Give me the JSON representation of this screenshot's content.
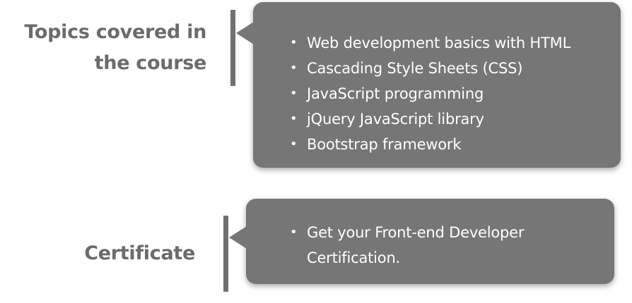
{
  "sections": [
    {
      "heading_lines": [
        "Topics covered in",
        "the course"
      ],
      "items": [
        "Web development basics with HTML",
        "Cascading Style Sheets (CSS)",
        "JavaScript programming",
        "jQuery JavaScript library",
        "Bootstrap framework"
      ]
    },
    {
      "heading_lines": [
        "Certificate"
      ],
      "items": [
        "Get your Front-end Developer Certification."
      ]
    }
  ],
  "colors": {
    "heading": "#6b6b6b",
    "bubble_bg": "#767676",
    "bubble_text": "#ffffff",
    "bar": "#707070"
  },
  "bullet_glyph": "•"
}
